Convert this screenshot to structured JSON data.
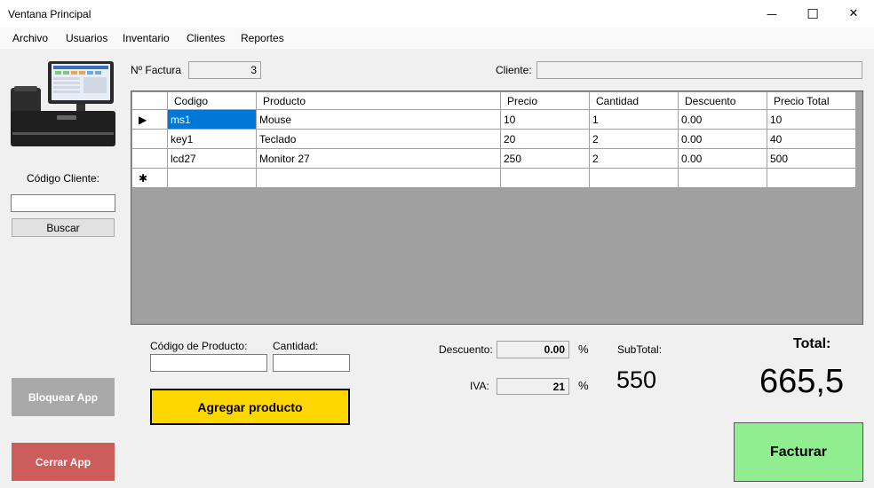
{
  "window": {
    "title": "Ventana Principal",
    "minimize_glyph": "—",
    "maximize_glyph": "☐",
    "close_glyph": "✕"
  },
  "menu": {
    "items": [
      "Archivo",
      "Usuarios",
      "Inventario",
      "Clientes",
      "Reportes"
    ]
  },
  "left": {
    "image_icon": "pos-terminal-icon",
    "codigo_cliente_label": "Código Cliente:",
    "codigo_cliente_value": "",
    "buscar_label": "Buscar",
    "bloquear_label": "Bloquear App",
    "cerrar_label": "Cerrar App"
  },
  "header": {
    "factura_label": "Nº Factura",
    "factura_value": "3",
    "cliente_label": "Cliente:",
    "cliente_value": ""
  },
  "grid": {
    "columns": [
      "Codigo",
      "Producto",
      "Precio",
      "Cantidad",
      "Descuento",
      "Precio Total"
    ],
    "rows": [
      [
        "ms1",
        "Mouse",
        "10",
        "1",
        "0.00",
        "10"
      ],
      [
        "key1",
        "Teclado",
        "20",
        "2",
        "0.00",
        "40"
      ],
      [
        "lcd27",
        "Monitor 27",
        "250",
        "2",
        "0.00",
        "500"
      ]
    ],
    "current_row_marker": "▶",
    "new_row_marker": "✱"
  },
  "entry": {
    "codigo_producto_label": "Código de Producto:",
    "codigo_producto_value": "",
    "cantidad_label": "Cantidad:",
    "cantidad_value": "",
    "agregar_label": "Agregar producto"
  },
  "totals": {
    "descuento_label": "Descuento:",
    "descuento_value": "0.00",
    "percent": "%",
    "iva_label": "IVA:",
    "iva_value": "21",
    "subtotal_label": "SubTotal:",
    "subtotal_value": "550",
    "total_label": "Total:",
    "total_value": "665,5",
    "facturar_label": "Facturar"
  },
  "colors": {
    "agregar_bg": "#ffd700",
    "bloquear_bg": "#a9a9a9",
    "cerrar_bg": "#cd5c5c",
    "facturar_bg": "#90ee90",
    "selection": "#0078d7"
  }
}
